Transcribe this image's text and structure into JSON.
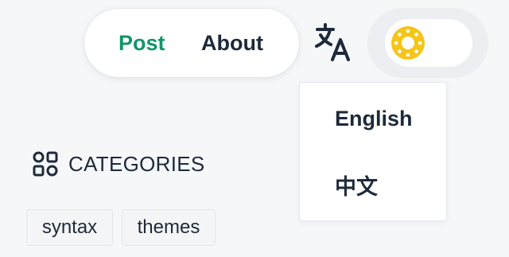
{
  "nav": {
    "links": [
      {
        "label": "Post",
        "active": true
      },
      {
        "label": "About",
        "active": false
      }
    ]
  },
  "icons": {
    "translate": "translate-icon",
    "theme": "sun-icon",
    "categories": "categories-grid-icon"
  },
  "language_menu": {
    "items": [
      "English",
      "中文"
    ]
  },
  "categories": {
    "title": "CATEGORIES",
    "tags": [
      "syntax",
      "themes"
    ]
  },
  "colors": {
    "accent": "#10956a",
    "sun": "#f5c518"
  }
}
